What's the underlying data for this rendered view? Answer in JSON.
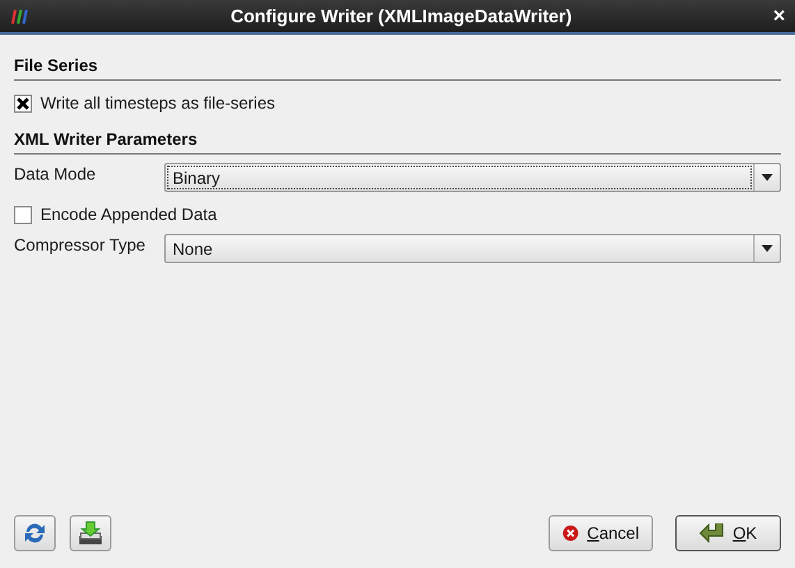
{
  "window": {
    "title": "Configure Writer (XMLImageDataWriter)",
    "close": "×"
  },
  "sections": [
    {
      "title": "File Series",
      "rows": [
        {
          "kind": "checkbox",
          "label": "Write all timesteps as file-series",
          "checked": true
        }
      ]
    },
    {
      "title": "XML Writer Parameters",
      "rows": [
        {
          "kind": "combo",
          "label": "Data Mode",
          "value": "Binary",
          "focused": true
        },
        {
          "kind": "checkbox",
          "label": "Encode Appended Data",
          "checked": false
        },
        {
          "kind": "combo",
          "label": "Compressor Type",
          "value": "None",
          "focused": false
        }
      ]
    }
  ],
  "buttons": [
    {
      "kind": "cancel",
      "label": "Cancel",
      "default": false
    },
    {
      "kind": "ok",
      "label": "OK",
      "default": true
    }
  ]
}
